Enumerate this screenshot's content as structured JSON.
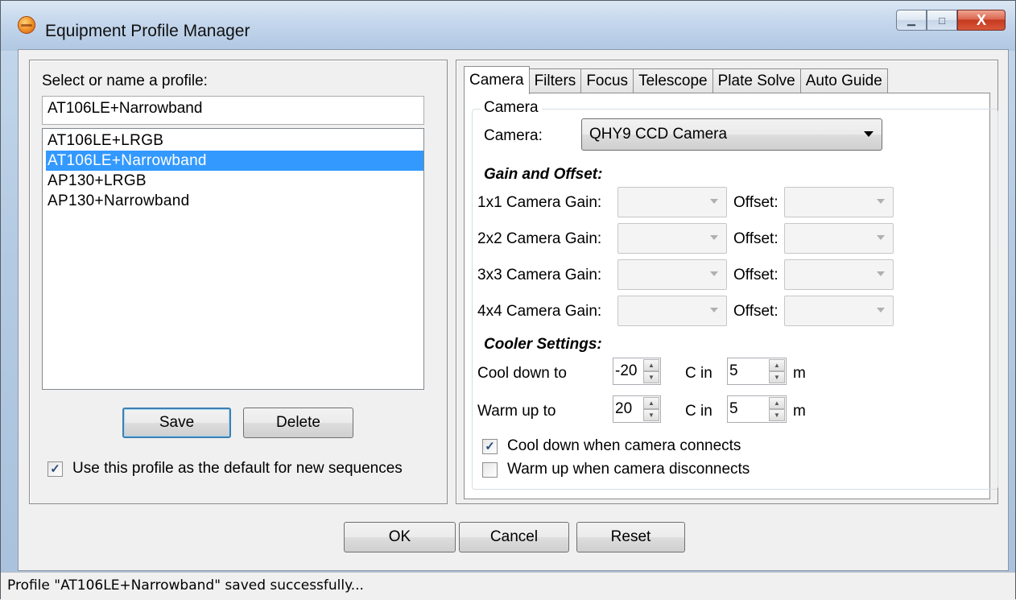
{
  "window": {
    "title": "Equipment Profile Manager",
    "minimize": "▁",
    "maximize": "□",
    "close": "X"
  },
  "profiles": {
    "prompt": "Select or name a profile:",
    "name_value": "AT106LE+Narrowband",
    "list": [
      {
        "label": "AT106LE+LRGB",
        "selected": false
      },
      {
        "label": "AT106LE+Narrowband",
        "selected": true
      },
      {
        "label": "AP130+LRGB",
        "selected": false
      },
      {
        "label": "AP130+Narrowband",
        "selected": false
      }
    ],
    "save_label": "Save",
    "delete_label": "Delete",
    "default_checkbox": {
      "label": "Use this profile as the default for new sequences",
      "checked": true
    }
  },
  "tabs": [
    {
      "label": "Camera",
      "active": true
    },
    {
      "label": "Filters",
      "active": false
    },
    {
      "label": "Focus",
      "active": false
    },
    {
      "label": "Telescope",
      "active": false
    },
    {
      "label": "Plate Solve",
      "active": false
    },
    {
      "label": "Auto Guide",
      "active": false
    }
  ],
  "camera": {
    "group_title": "Camera",
    "camera_label": "Camera:",
    "camera_value": "QHY9 CCD Camera",
    "gain_offset_heading": "Gain and Offset:",
    "gain_rows": [
      {
        "label": "1x1 Camera Gain:",
        "offset_label": "Offset:"
      },
      {
        "label": "2x2 Camera Gain:",
        "offset_label": "Offset:"
      },
      {
        "label": "3x3 Camera Gain:",
        "offset_label": "Offset:"
      },
      {
        "label": "4x4 Camera Gain:",
        "offset_label": "Offset:"
      }
    ],
    "cooler_heading": "Cooler Settings:",
    "cool_down": {
      "label": "Cool down to",
      "temp": "-20",
      "temp_unit": "C in",
      "minutes": "5",
      "minutes_unit": "m"
    },
    "warm_up": {
      "label": "Warm up to",
      "temp": "20",
      "temp_unit": "C in",
      "minutes": "5",
      "minutes_unit": "m"
    },
    "cool_on_connect": {
      "label": "Cool down when camera connects",
      "checked": true
    },
    "warm_on_disconnect": {
      "label": "Warm up when camera disconnects",
      "checked": false
    }
  },
  "footer": {
    "ok_label": "OK",
    "cancel_label": "Cancel",
    "reset_label": "Reset"
  },
  "status": {
    "message": "Profile \"AT106LE+Narrowband\" saved successfully..."
  }
}
